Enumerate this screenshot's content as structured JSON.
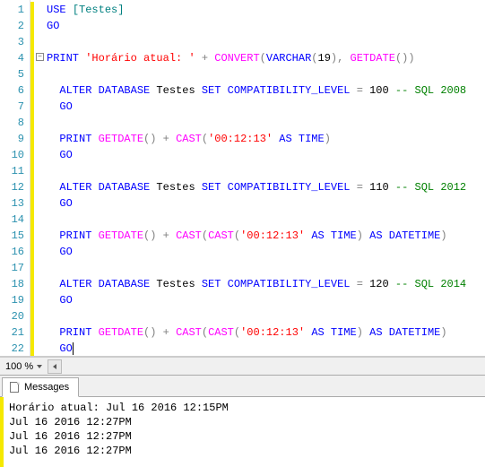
{
  "editor": {
    "line_count": 22,
    "fold_glyph": "−",
    "code": [
      [
        {
          "t": "USE",
          "c": "kw"
        },
        {
          "t": " "
        },
        {
          "t": "[Testes]",
          "c": "teal"
        }
      ],
      [
        {
          "t": "GO",
          "c": "kw"
        }
      ],
      [],
      [
        {
          "fold": true
        },
        {
          "t": "PRINT",
          "c": "kw"
        },
        {
          "t": " "
        },
        {
          "t": "'Horário atual: '",
          "c": "str"
        },
        {
          "t": " "
        },
        {
          "t": "+",
          "c": "op"
        },
        {
          "t": " "
        },
        {
          "t": "CONVERT",
          "c": "fn"
        },
        {
          "t": "(",
          "c": "gray"
        },
        {
          "t": "VARCHAR",
          "c": "kw"
        },
        {
          "t": "(",
          "c": "gray"
        },
        {
          "t": "19",
          "c": "num"
        },
        {
          "t": ")",
          "c": "gray"
        },
        {
          "t": ",",
          "c": "gray"
        },
        {
          "t": " "
        },
        {
          "t": "GETDATE",
          "c": "fn"
        },
        {
          "t": "()",
          "c": "gray"
        },
        {
          "t": ")",
          "c": "gray"
        }
      ],
      [],
      [
        {
          "t": "  "
        },
        {
          "t": "ALTER",
          "c": "kw"
        },
        {
          "t": " "
        },
        {
          "t": "DATABASE",
          "c": "kw"
        },
        {
          "t": " Testes ",
          "c": "id"
        },
        {
          "t": "SET",
          "c": "kw"
        },
        {
          "t": " "
        },
        {
          "t": "COMPATIBILITY_LEVEL",
          "c": "kw"
        },
        {
          "t": " "
        },
        {
          "t": "=",
          "c": "op"
        },
        {
          "t": " "
        },
        {
          "t": "100",
          "c": "num"
        },
        {
          "t": " "
        },
        {
          "t": "-- SQL 2008",
          "c": "sys"
        }
      ],
      [
        {
          "t": "  "
        },
        {
          "t": "GO",
          "c": "kw"
        }
      ],
      [],
      [
        {
          "t": "  "
        },
        {
          "t": "PRINT",
          "c": "kw"
        },
        {
          "t": " "
        },
        {
          "t": "GETDATE",
          "c": "fn"
        },
        {
          "t": "()",
          "c": "gray"
        },
        {
          "t": " "
        },
        {
          "t": "+",
          "c": "op"
        },
        {
          "t": " "
        },
        {
          "t": "CAST",
          "c": "fn"
        },
        {
          "t": "(",
          "c": "gray"
        },
        {
          "t": "'00:12:13'",
          "c": "str"
        },
        {
          "t": " "
        },
        {
          "t": "AS",
          "c": "kw"
        },
        {
          "t": " "
        },
        {
          "t": "TIME",
          "c": "kw"
        },
        {
          "t": ")",
          "c": "gray"
        }
      ],
      [
        {
          "t": "  "
        },
        {
          "t": "GO",
          "c": "kw"
        }
      ],
      [],
      [
        {
          "t": "  "
        },
        {
          "t": "ALTER",
          "c": "kw"
        },
        {
          "t": " "
        },
        {
          "t": "DATABASE",
          "c": "kw"
        },
        {
          "t": " Testes ",
          "c": "id"
        },
        {
          "t": "SET",
          "c": "kw"
        },
        {
          "t": " "
        },
        {
          "t": "COMPATIBILITY_LEVEL",
          "c": "kw"
        },
        {
          "t": " "
        },
        {
          "t": "=",
          "c": "op"
        },
        {
          "t": " "
        },
        {
          "t": "110",
          "c": "num"
        },
        {
          "t": " "
        },
        {
          "t": "-- SQL 2012",
          "c": "sys"
        }
      ],
      [
        {
          "t": "  "
        },
        {
          "t": "GO",
          "c": "kw"
        }
      ],
      [],
      [
        {
          "t": "  "
        },
        {
          "t": "PRINT",
          "c": "kw"
        },
        {
          "t": " "
        },
        {
          "t": "GETDATE",
          "c": "fn"
        },
        {
          "t": "()",
          "c": "gray"
        },
        {
          "t": " "
        },
        {
          "t": "+",
          "c": "op"
        },
        {
          "t": " "
        },
        {
          "t": "CAST",
          "c": "fn"
        },
        {
          "t": "(",
          "c": "gray"
        },
        {
          "t": "CAST",
          "c": "fn"
        },
        {
          "t": "(",
          "c": "gray"
        },
        {
          "t": "'00:12:13'",
          "c": "str"
        },
        {
          "t": " "
        },
        {
          "t": "AS",
          "c": "kw"
        },
        {
          "t": " "
        },
        {
          "t": "TIME",
          "c": "kw"
        },
        {
          "t": ")",
          "c": "gray"
        },
        {
          "t": " "
        },
        {
          "t": "AS",
          "c": "kw"
        },
        {
          "t": " "
        },
        {
          "t": "DATETIME",
          "c": "kw"
        },
        {
          "t": ")",
          "c": "gray"
        }
      ],
      [
        {
          "t": "  "
        },
        {
          "t": "GO",
          "c": "kw"
        }
      ],
      [],
      [
        {
          "t": "  "
        },
        {
          "t": "ALTER",
          "c": "kw"
        },
        {
          "t": " "
        },
        {
          "t": "DATABASE",
          "c": "kw"
        },
        {
          "t": " Testes ",
          "c": "id"
        },
        {
          "t": "SET",
          "c": "kw"
        },
        {
          "t": " "
        },
        {
          "t": "COMPATIBILITY_LEVEL",
          "c": "kw"
        },
        {
          "t": " "
        },
        {
          "t": "=",
          "c": "op"
        },
        {
          "t": " "
        },
        {
          "t": "120",
          "c": "num"
        },
        {
          "t": " "
        },
        {
          "t": "-- SQL 2014",
          "c": "sys"
        }
      ],
      [
        {
          "t": "  "
        },
        {
          "t": "GO",
          "c": "kw"
        }
      ],
      [],
      [
        {
          "t": "  "
        },
        {
          "t": "PRINT",
          "c": "kw"
        },
        {
          "t": " "
        },
        {
          "t": "GETDATE",
          "c": "fn"
        },
        {
          "t": "()",
          "c": "gray"
        },
        {
          "t": " "
        },
        {
          "t": "+",
          "c": "op"
        },
        {
          "t": " "
        },
        {
          "t": "CAST",
          "c": "fn"
        },
        {
          "t": "(",
          "c": "gray"
        },
        {
          "t": "CAST",
          "c": "fn"
        },
        {
          "t": "(",
          "c": "gray"
        },
        {
          "t": "'00:12:13'",
          "c": "str"
        },
        {
          "t": " "
        },
        {
          "t": "AS",
          "c": "kw"
        },
        {
          "t": " "
        },
        {
          "t": "TIME",
          "c": "kw"
        },
        {
          "t": ")",
          "c": "gray"
        },
        {
          "t": " "
        },
        {
          "t": "AS",
          "c": "kw"
        },
        {
          "t": " "
        },
        {
          "t": "DATETIME",
          "c": "kw"
        },
        {
          "t": ")",
          "c": "gray"
        }
      ],
      [
        {
          "t": "  "
        },
        {
          "t": "GO",
          "c": "kw"
        },
        {
          "cursor": true
        }
      ]
    ]
  },
  "zoom": {
    "label": "100 %"
  },
  "results": {
    "tab_label": "Messages",
    "lines": [
      "Horário atual: Jul 16 2016 12:15PM",
      "Jul 16 2016 12:27PM",
      "Jul 16 2016 12:27PM",
      "Jul 16 2016 12:27PM"
    ]
  }
}
